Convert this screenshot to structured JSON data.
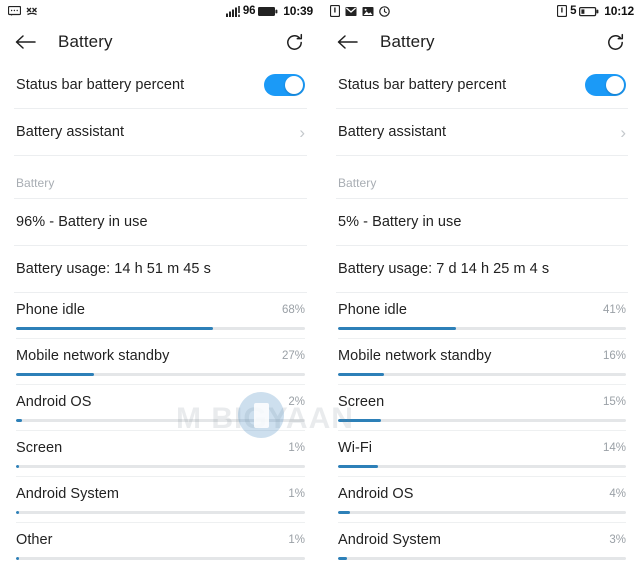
{
  "app": {
    "title": "Battery",
    "accent_color": "#2d80b8",
    "toggle_on_color": "#1b9af7",
    "track_color": "#e4e6e8"
  },
  "watermark": {
    "text": "M   BIGYAAN"
  },
  "screens": [
    {
      "id": "left",
      "statusbar": {
        "left_icons": [
          "message-icon",
          "mute-icon"
        ],
        "signal_icon": "signal-bars-icon",
        "battery_percent": "96",
        "battery_icon": "battery-full-icon",
        "time": "10:39"
      },
      "appbar": {
        "back_icon": "back-arrow-icon",
        "title": "Battery",
        "refresh_icon": "refresh-icon"
      },
      "settings": [
        {
          "label": "Status bar battery percent",
          "type": "toggle",
          "value": "on"
        },
        {
          "label": "Battery assistant",
          "type": "link",
          "chevron": "›"
        }
      ],
      "section_label": "Battery",
      "status_rows": [
        {
          "label": "96% - Battery in use"
        },
        {
          "label": "Battery usage: 14 h 51 m 45 s"
        }
      ],
      "usage": [
        {
          "name": "Phone idle",
          "percent": "68%",
          "value": 68
        },
        {
          "name": "Mobile network standby",
          "percent": "27%",
          "value": 27
        },
        {
          "name": "Android OS",
          "percent": "2%",
          "value": 2
        },
        {
          "name": "Screen",
          "percent": "1%",
          "value": 1
        },
        {
          "name": "Android System",
          "percent": "1%",
          "value": 1
        },
        {
          "name": "Other",
          "percent": "1%",
          "value": 1
        }
      ]
    },
    {
      "id": "right",
      "statusbar": {
        "left_icons": [
          "sim-card-icon",
          "gmail-icon",
          "screenshot-icon",
          "clock-icon"
        ],
        "signal_icon": "sim-icon",
        "battery_percent": "5",
        "battery_icon": "battery-low-icon",
        "time": "10:12"
      },
      "appbar": {
        "back_icon": "back-arrow-icon",
        "title": "Battery",
        "refresh_icon": "refresh-icon"
      },
      "settings": [
        {
          "label": "Status bar battery percent",
          "type": "toggle",
          "value": "on"
        },
        {
          "label": "Battery assistant",
          "type": "link",
          "chevron": "›"
        }
      ],
      "section_label": "Battery",
      "status_rows": [
        {
          "label": "5% - Battery in use"
        },
        {
          "label": "Battery usage: 7 d 14 h 25 m 4 s"
        }
      ],
      "usage": [
        {
          "name": "Phone idle",
          "percent": "41%",
          "value": 41
        },
        {
          "name": "Mobile network standby",
          "percent": "16%",
          "value": 16
        },
        {
          "name": "Screen",
          "percent": "15%",
          "value": 15
        },
        {
          "name": "Wi-Fi",
          "percent": "14%",
          "value": 14
        },
        {
          "name": "Android OS",
          "percent": "4%",
          "value": 4
        },
        {
          "name": "Android System",
          "percent": "3%",
          "value": 3
        }
      ]
    }
  ]
}
